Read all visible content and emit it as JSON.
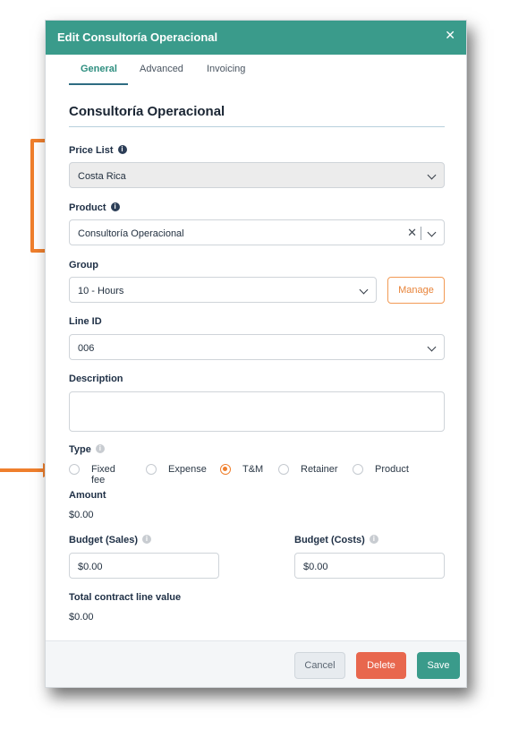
{
  "modal": {
    "title": "Edit Consultoría Operacional",
    "close_icon": "close-icon"
  },
  "tabs": [
    {
      "label": "General",
      "active": true
    },
    {
      "label": "Advanced",
      "active": false
    },
    {
      "label": "Invoicing",
      "active": false
    }
  ],
  "form": {
    "title": "Consultoría Operacional",
    "price_list": {
      "label": "Price List",
      "value": "Costa Rica"
    },
    "product": {
      "label": "Product",
      "value": "Consultoría Operacional"
    },
    "group": {
      "label": "Group",
      "value": "10 - Hours",
      "manage_label": "Manage"
    },
    "line_id": {
      "label": "Line ID",
      "value": "006"
    },
    "description": {
      "label": "Description",
      "value": ""
    },
    "type": {
      "label": "Type",
      "options": [
        "Fixed fee",
        "Expense",
        "T&M",
        "Retainer",
        "Product"
      ],
      "selected": "T&M"
    },
    "amount": {
      "label": "Amount",
      "value": "$0.00"
    },
    "budget_sales": {
      "label": "Budget (Sales)",
      "value": "$0.00"
    },
    "budget_costs": {
      "label": "Budget (Costs)",
      "value": "$0.00"
    },
    "total": {
      "label": "Total contract line value",
      "value": "$0.00"
    }
  },
  "footer": {
    "cancel_label": "Cancel",
    "delete_label": "Delete",
    "save_label": "Save"
  },
  "colors": {
    "header": "#3a9b8b",
    "accent_orange": "#ef7f2d",
    "delete": "#e8674e",
    "save": "#3a9b8b"
  }
}
